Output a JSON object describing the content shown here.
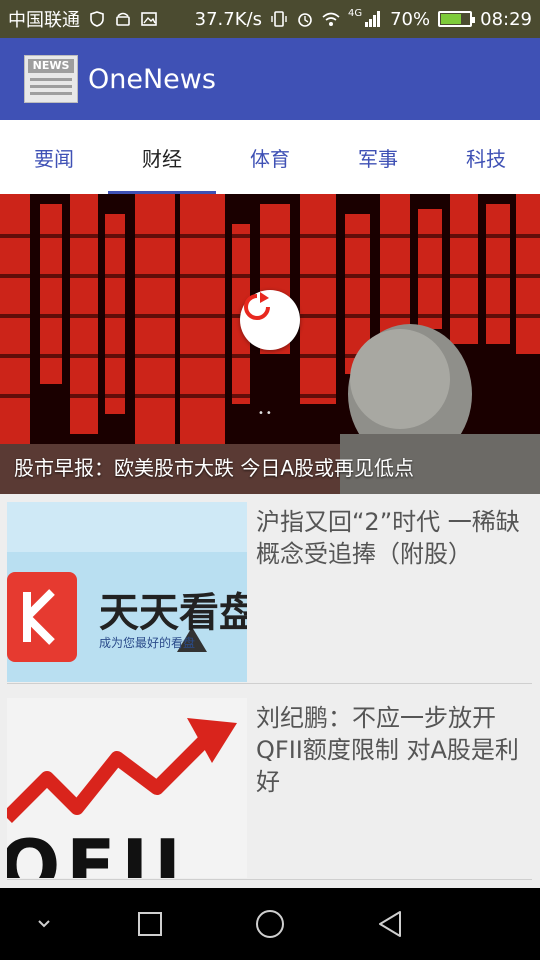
{
  "status_bar": {
    "carrier": "中国联通",
    "network_speed": "37.7K/s",
    "network_type": "4G",
    "battery_percent": "70%",
    "battery_level": 0.7,
    "time": "08:29"
  },
  "app_bar": {
    "logo_text": "NEWS",
    "title": "OneNews"
  },
  "tabs": [
    {
      "label": "要闻",
      "active": false
    },
    {
      "label": "财经",
      "active": true
    },
    {
      "label": "体育",
      "active": false
    },
    {
      "label": "军事",
      "active": false
    },
    {
      "label": "科技",
      "active": false
    }
  ],
  "banner": {
    "caption": "股市早报：欧美股市大跌 今日A股或再见低点"
  },
  "news": [
    {
      "title": "沪指又回“2”时代 一稀缺概念受追捧（附股）",
      "thumb_text": "天天看盘",
      "thumb_subtext": "成为您最好的看盘",
      "thumb_logo": "K"
    },
    {
      "title": "刘纪鹏：不应一步放开QFII额度限制 对A股是利好",
      "thumb_text": "QFII"
    }
  ],
  "nav_bar": {
    "icons": [
      "chevron-down-icon",
      "square-icon",
      "circle-icon",
      "back-triangle-icon"
    ]
  },
  "colors": {
    "primary": "#3f51b5",
    "status_bar": "#4b4b30",
    "banner_red": "#e0281c"
  }
}
